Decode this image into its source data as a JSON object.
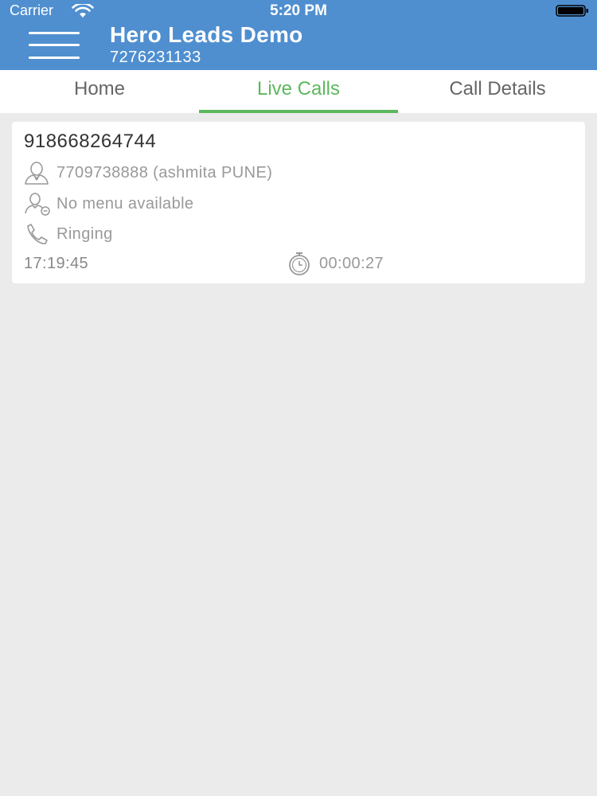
{
  "status_bar": {
    "carrier": "Carrier",
    "time": "5:20 PM",
    "wifi_icon": "wifi-icon",
    "battery_icon": "battery-icon"
  },
  "header": {
    "menu_icon": "hamburger-menu-icon",
    "title": "Hero Leads Demo",
    "subtitle": "7276231133",
    "background_color": "#4f8fd0"
  },
  "tabs": [
    {
      "label": "Home",
      "active": false
    },
    {
      "label": "Live Calls",
      "active": true
    },
    {
      "label": "Call Details",
      "active": false
    }
  ],
  "accent_color": "#5cb85c",
  "live_call": {
    "number": "918668264744",
    "agent": "7709738888 (ashmita PUNE)",
    "menu": "No menu available",
    "status": "Ringing",
    "time": "17:19:45",
    "duration": "00:00:27",
    "icons": {
      "agent": "person-icon",
      "menu": "person-menu-icon",
      "status": "phone-icon",
      "duration": "stopwatch-icon"
    }
  }
}
